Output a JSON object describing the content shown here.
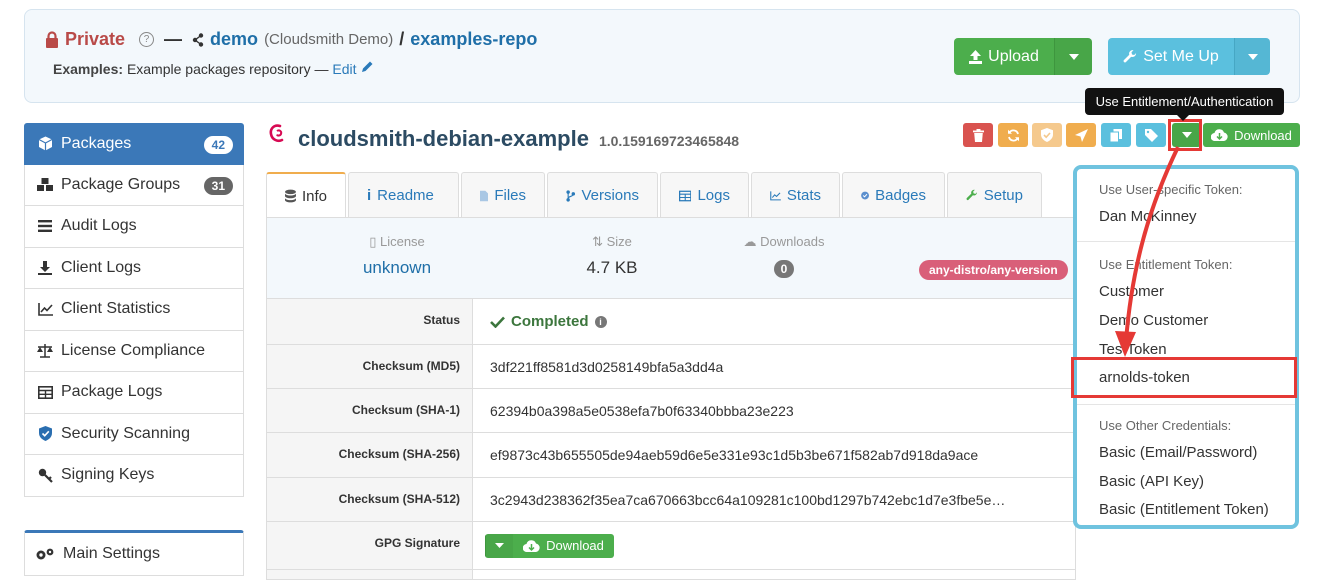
{
  "header": {
    "private_label": "Private",
    "help": "?",
    "dash": "—",
    "org": "demo",
    "org_full": "(Cloudsmith Demo)",
    "slash": "/",
    "repo": "examples-repo",
    "desc_label": "Examples:",
    "desc": "Example packages repository",
    "desc_dash": "—",
    "edit": "Edit",
    "upload": "Upload",
    "setmeup": "Set Me Up"
  },
  "sidebar": {
    "items": [
      {
        "label": "Packages",
        "badge": "42",
        "icon": "cube-icon"
      },
      {
        "label": "Package Groups",
        "badge": "31",
        "icon": "cubes-icon"
      },
      {
        "label": "Audit Logs",
        "icon": "list-icon"
      },
      {
        "label": "Client Logs",
        "icon": "download-icon"
      },
      {
        "label": "Client Statistics",
        "icon": "chart-icon"
      },
      {
        "label": "License Compliance",
        "icon": "scale-icon"
      },
      {
        "label": "Package Logs",
        "icon": "table-icon"
      },
      {
        "label": "Security Scanning",
        "icon": "shield-icon"
      },
      {
        "label": "Signing Keys",
        "icon": "key-icon"
      }
    ],
    "main_settings": "Main Settings"
  },
  "package": {
    "name": "cloudsmith-debian-example",
    "version": "1.0.159169723465848",
    "download": "Download"
  },
  "tabs": [
    "Info",
    "Readme",
    "Files",
    "Versions",
    "Logs",
    "Stats",
    "Badges",
    "Setup"
  ],
  "stats": {
    "license_label": "License",
    "license_value": "unknown",
    "size_label": "Size",
    "size_value": "4.7 KB",
    "downloads_label": "Downloads",
    "downloads_value": "0",
    "distro": "any-distro/any-version"
  },
  "details": {
    "status_label": "Status",
    "status_value": "Completed",
    "md5_label": "Checksum (MD5)",
    "md5": "3df221ff8581d3d0258149bfa5a3dd4a",
    "sha1_label": "Checksum (SHA-1)",
    "sha1": "62394b0a398a5e0538efa7b0f63340bbba23e223",
    "sha256_label": "Checksum (SHA-256)",
    "sha256": "ef9873c43b655505de94aeb59d6e5e331e93c1d5b3be671f582ab7d918da9ace",
    "sha512_label": "Checksum (SHA-512)",
    "sha512": "3c2943d238362f35ea7ca670663bcc64a109281c100bd1297b742ebc1d7e3fbe5e…",
    "gpg_label": "GPG Signature",
    "gpg_download": "Download"
  },
  "tooltip": "Use Entitlement/Authentication",
  "dropdown": {
    "user_header": "Use User-specific Token:",
    "user": "Dan McKinney",
    "ent_header": "Use Entitlement Token:",
    "tokens": [
      "Customer",
      "Demo Customer",
      "TestToken",
      "arnolds-token"
    ],
    "other_header": "Use Other Credentials:",
    "other": [
      "Basic (Email/Password)",
      "Basic (API Key)",
      "Basic (Entitlement Token)"
    ]
  },
  "colors": {
    "green": "#4cae4c",
    "teal": "#5bc0de",
    "primary": "#3b78b8",
    "highlight": "#e53935"
  }
}
